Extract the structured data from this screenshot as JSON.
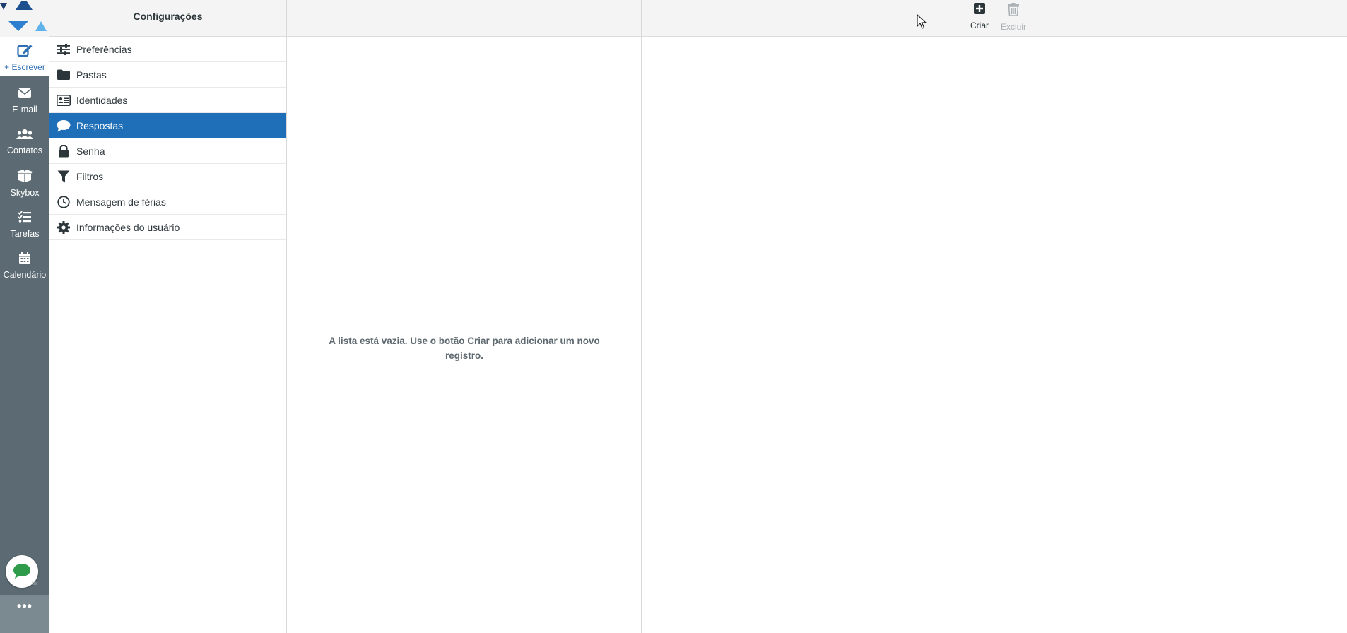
{
  "nav": {
    "compose_label": "+ Escrever",
    "items": [
      {
        "label": "E-mail",
        "icon": "envelope-icon"
      },
      {
        "label": "Contatos",
        "icon": "users-icon"
      },
      {
        "label": "Skybox",
        "icon": "box-icon"
      },
      {
        "label": "Tarefas",
        "icon": "tasks-icon"
      },
      {
        "label": "Calendário",
        "icon": "calendar-icon"
      }
    ],
    "more_label": "•••"
  },
  "settings": {
    "title": "Configurações",
    "items": [
      {
        "label": "Preferências",
        "icon": "sliders-icon",
        "active": false
      },
      {
        "label": "Pastas",
        "icon": "folder-icon",
        "active": false
      },
      {
        "label": "Identidades",
        "icon": "id-card-icon",
        "active": false
      },
      {
        "label": "Respostas",
        "icon": "comment-icon",
        "active": true
      },
      {
        "label": "Senha",
        "icon": "lock-icon",
        "active": false
      },
      {
        "label": "Filtros",
        "icon": "filter-icon",
        "active": false
      },
      {
        "label": "Mensagem de férias",
        "icon": "clock-icon",
        "active": false
      },
      {
        "label": "Informações do usuário",
        "icon": "gear-icon",
        "active": false
      }
    ]
  },
  "list": {
    "empty_message": "A lista está vazia. Use o botão Criar para adicionar um novo registro."
  },
  "toolbar": {
    "create_label": "Criar",
    "delete_label": "Excluir"
  },
  "colors": {
    "rail": "#5c6b73",
    "active": "#1f6fb8",
    "compose_text": "#2f6fb4",
    "chat_green": "#2e9b4b"
  }
}
